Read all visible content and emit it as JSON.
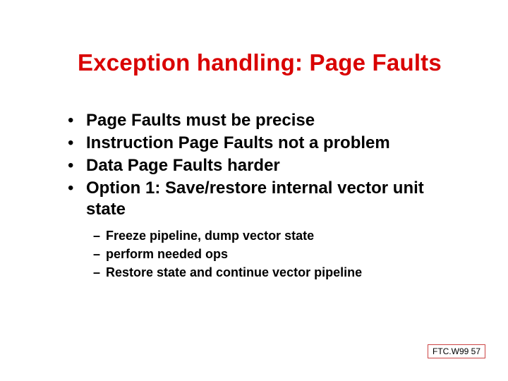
{
  "title": "Exception handling: Page Faults",
  "bullets": [
    "Page Faults must be precise",
    "Instruction Page Faults not a problem",
    "Data Page Faults harder",
    "Option 1: Save/restore internal vector unit state"
  ],
  "subbullets": [
    "Freeze pipeline, dump vector state",
    "perform needed ops",
    "Restore state and continue vector pipeline"
  ],
  "footer": "FTC.W99 57"
}
